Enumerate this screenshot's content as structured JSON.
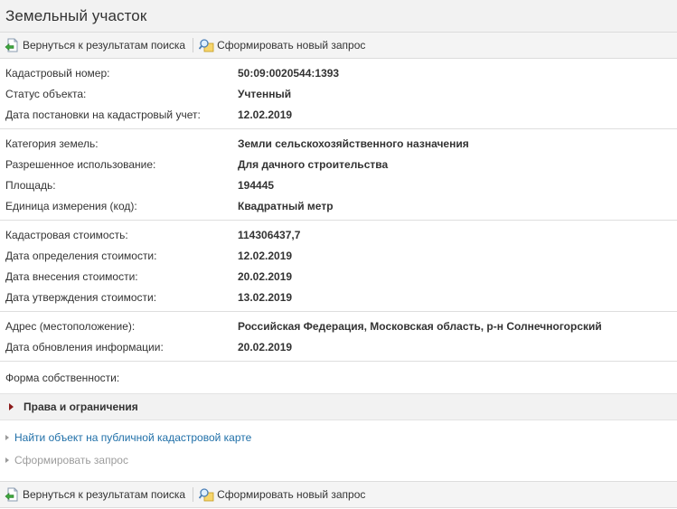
{
  "title": "Земельный участок",
  "toolbar": {
    "back_label": "Вернуться к результатам поиска",
    "new_query_label": "Сформировать новый запрос"
  },
  "groups": [
    [
      {
        "label": "Кадастровый номер:",
        "value": "50:09:0020544:1393"
      },
      {
        "label": "Статус объекта:",
        "value": "Учтенный"
      },
      {
        "label": "Дата постановки на кадастровый учет:",
        "value": "12.02.2019"
      }
    ],
    [
      {
        "label": "Категория земель:",
        "value": "Земли сельскохозяйственного назначения"
      },
      {
        "label": "Разрешенное использование:",
        "value": "Для дачного строительства"
      },
      {
        "label": "Площадь:",
        "value": "194445"
      },
      {
        "label": "Единица измерения (код):",
        "value": "Квадратный метр"
      }
    ],
    [
      {
        "label": "Кадастровая стоимость:",
        "value": "114306437,7"
      },
      {
        "label": "Дата определения стоимости:",
        "value": "12.02.2019"
      },
      {
        "label": "Дата внесения стоимости:",
        "value": "20.02.2019"
      },
      {
        "label": "Дата утверждения стоимости:",
        "value": "13.02.2019"
      }
    ],
    [
      {
        "label": "Адрес (местоположение):",
        "value": "Российская Федерация, Московская область, р-н Солнечногорский"
      },
      {
        "label": "Дата обновления информации:",
        "value": "20.02.2019"
      }
    ],
    [
      {
        "label": "Форма собственности:",
        "value": ""
      }
    ]
  ],
  "rights_section": {
    "label": "Права и ограничения",
    "icon": "triangle-right-icon"
  },
  "links": {
    "public_map": "Найти объект на публичной кадастровой карте",
    "form_request": "Сформировать запрос"
  },
  "colors": {
    "link": "#1f6fa8",
    "disabled": "#9c9c9c",
    "toolbar_bg": "#f4f4f4",
    "section_triangle": "#8b1a1a"
  }
}
